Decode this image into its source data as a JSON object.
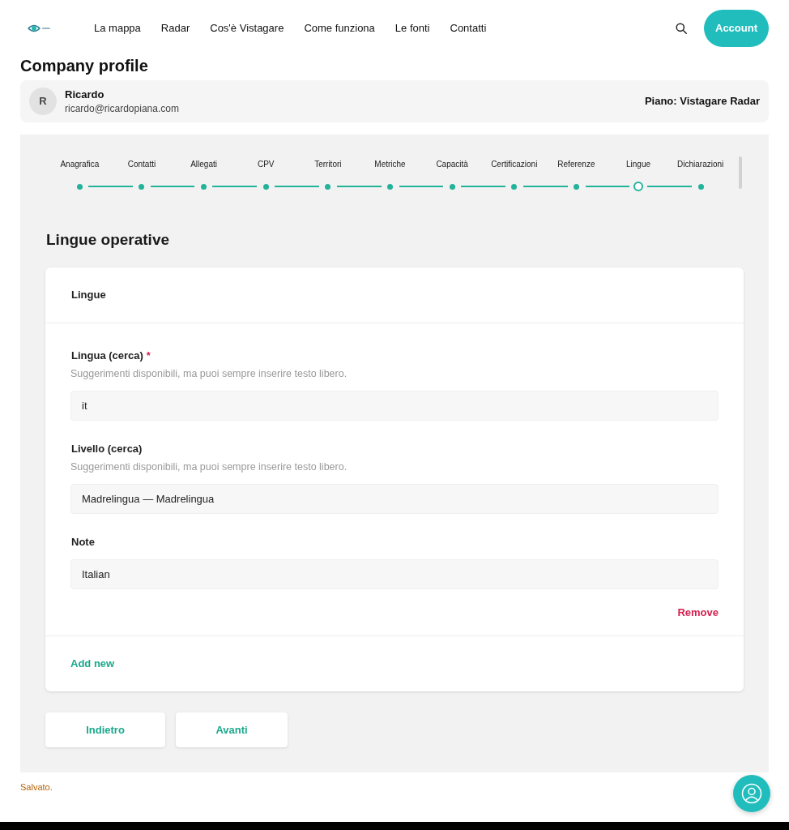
{
  "header": {
    "nav_links": [
      "La mappa",
      "Radar",
      "Cos'è Vistagare",
      "Come funziona",
      "Le fonti",
      "Contatti"
    ],
    "account_button": "Account"
  },
  "page_title": "Company profile",
  "profile": {
    "initial": "R",
    "name": "Ricardo",
    "email": "ricardo@ricardopiana.com",
    "plan": "Piano: Vistagare Radar"
  },
  "steps": [
    {
      "label": "Anagrafica",
      "selected": false
    },
    {
      "label": "Contatti",
      "selected": false
    },
    {
      "label": "Allegati",
      "selected": false
    },
    {
      "label": "CPV",
      "selected": false
    },
    {
      "label": "Territori",
      "selected": false
    },
    {
      "label": "Metriche",
      "selected": false
    },
    {
      "label": "Capacità",
      "selected": false
    },
    {
      "label": "Certificazioni",
      "selected": false
    },
    {
      "label": "Referenze",
      "selected": false
    },
    {
      "label": "Lingue",
      "selected": true
    },
    {
      "label": "Dichiarazioni",
      "selected": false
    }
  ],
  "section_title": "Lingue operative",
  "card": {
    "title": "Lingue",
    "fields": [
      {
        "label": "Lingua (cerca)",
        "required_mark": "*",
        "hint": "Suggerimenti disponibili, ma puoi sempre inserire testo libero.",
        "value": "it"
      },
      {
        "label": "Livello (cerca)",
        "hint": "Suggerimenti disponibili, ma puoi sempre inserire testo libero.",
        "value": "Madrelingua — Madrelingua"
      },
      {
        "label": "Note",
        "value": "Italian"
      }
    ],
    "remove_link": "Remove",
    "add_link": "Add new"
  },
  "buttons": [
    "Indietro",
    "Avanti"
  ],
  "status": "Salvato."
}
